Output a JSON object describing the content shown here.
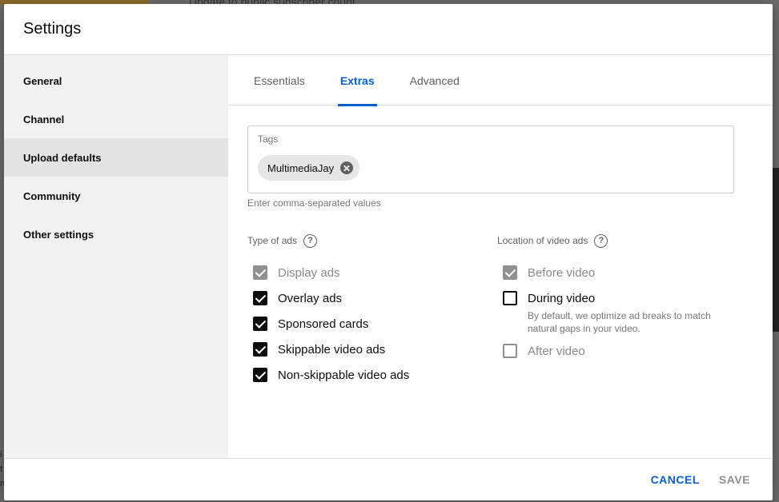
{
  "background": {
    "page_text": "Update to public subscriber count",
    "left_letters": [
      "i",
      "t",
      "n"
    ]
  },
  "dialog": {
    "title": "Settings"
  },
  "sidebar": {
    "items": [
      {
        "label": "General"
      },
      {
        "label": "Channel"
      },
      {
        "label": "Upload defaults"
      },
      {
        "label": "Community"
      },
      {
        "label": "Other settings"
      }
    ],
    "active": "Upload defaults"
  },
  "tabs": {
    "items": [
      {
        "label": "Essentials"
      },
      {
        "label": "Extras"
      },
      {
        "label": "Advanced"
      }
    ],
    "active": "Extras"
  },
  "tags": {
    "label": "Tags",
    "chips": [
      "MultimediaJay"
    ],
    "hint": "Enter comma-separated values"
  },
  "type_of_ads": {
    "heading": "Type of ads",
    "help_icon": "?",
    "items": [
      {
        "label": "Display ads",
        "checked": true,
        "disabled": true
      },
      {
        "label": "Overlay ads",
        "checked": true,
        "disabled": false
      },
      {
        "label": "Sponsored cards",
        "checked": true,
        "disabled": false
      },
      {
        "label": "Skippable video ads",
        "checked": true,
        "disabled": false
      },
      {
        "label": "Non-skippable video ads",
        "checked": true,
        "disabled": false
      }
    ]
  },
  "location_of_video_ads": {
    "heading": "Location of video ads",
    "help_icon": "?",
    "items": [
      {
        "label": "Before video",
        "checked": true,
        "disabled": true
      },
      {
        "label": "During video",
        "checked": false,
        "disabled": false,
        "note": "By default, we optimize ad breaks to match natural gaps in your video."
      },
      {
        "label": "After video",
        "checked": false,
        "disabled": true
      }
    ]
  },
  "footer": {
    "cancel_label": "CANCEL",
    "save_label": "SAVE"
  },
  "colors": {
    "accent": "#065fd4",
    "checkbox": "#0d0d0d",
    "disabled": "#909090"
  }
}
